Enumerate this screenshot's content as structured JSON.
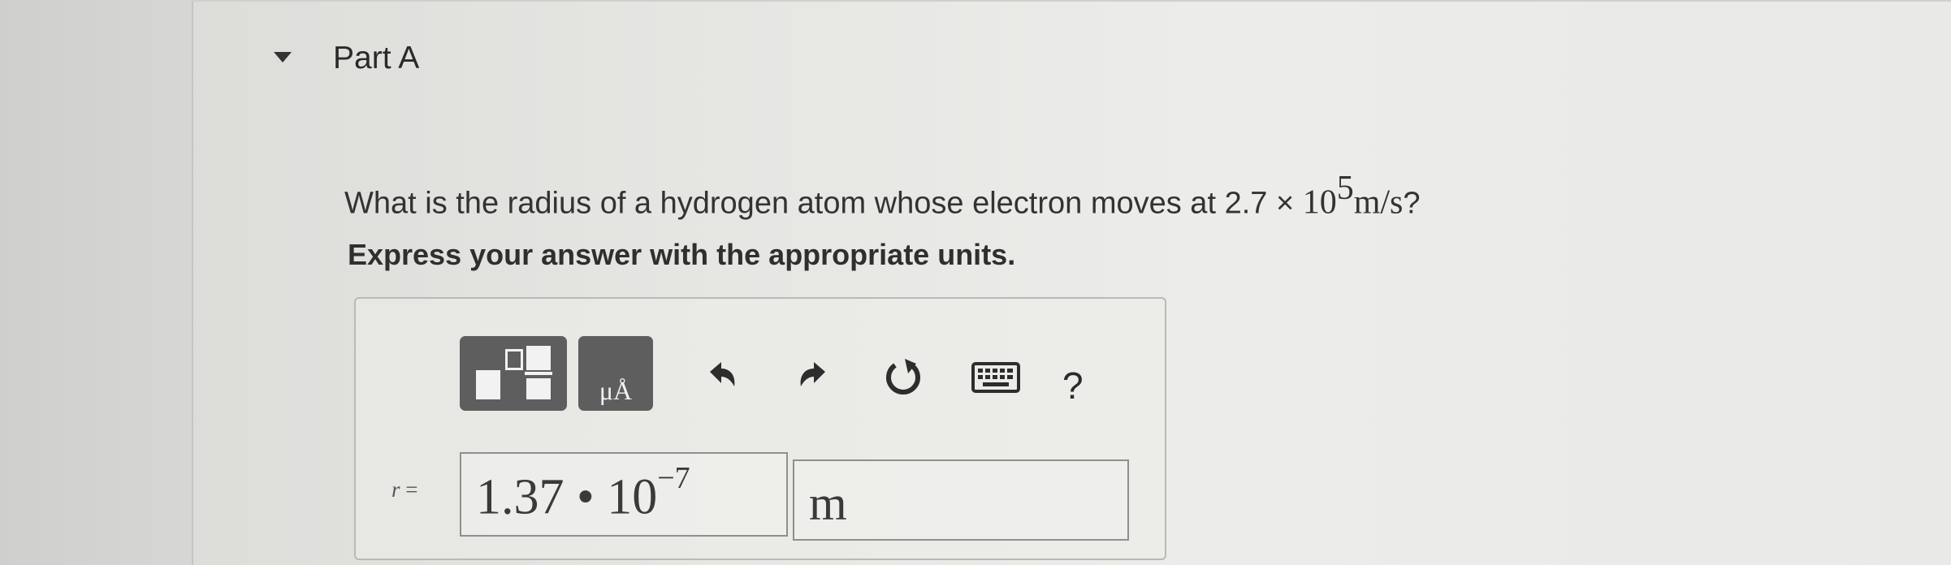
{
  "part": {
    "title": "Part A"
  },
  "question": {
    "prefix": "What is the radius of a hydrogen atom whose electron moves at",
    "coefficient": "2.7",
    "times": "×",
    "base": "10",
    "exponent": "5",
    "unit": "m/s",
    "suffix": "?"
  },
  "instruction": "Express your answer with the appropriate units.",
  "toolbar": {
    "templates_icon": "templates-icon",
    "units_label": "μÅ",
    "undo_icon": "undo-icon",
    "redo_icon": "redo-icon",
    "reset_icon": "reset-icon",
    "keyboard_icon": "keyboard-icon",
    "help_label": "?"
  },
  "answer": {
    "variable": "r",
    "equals": "=",
    "value_mantissa": "1.37 • 10",
    "value_exponent": "−7",
    "unit_value": "m"
  }
}
